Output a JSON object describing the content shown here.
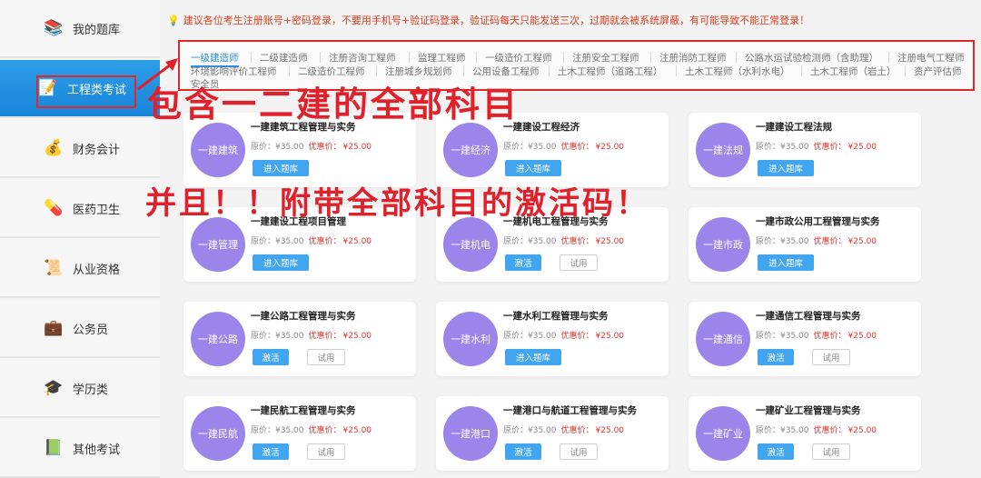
{
  "sidebar": {
    "items": [
      {
        "label": "我的题库",
        "icon": "books-icon"
      },
      {
        "label": "工程类考试",
        "icon": "pencil-paper-icon"
      },
      {
        "label": "财务会计",
        "icon": "coins-icon"
      },
      {
        "label": "医药卫生",
        "icon": "medicine-icon"
      },
      {
        "label": "从业资格",
        "icon": "certificate-icon"
      },
      {
        "label": "公务员",
        "icon": "briefcase-icon"
      },
      {
        "label": "学历类",
        "icon": "graduation-cap-icon"
      },
      {
        "label": "其他考试",
        "icon": "book-stack-icon"
      }
    ],
    "active_index": 1
  },
  "notice": "建议各位考生注册账号+密码登录，不要用手机号+验证码登录，验证码每天只能发送三次，过期就会被系统屏蔽，有可能导致不能正常登录！",
  "tabs": [
    "一级建造师",
    "二级建造师",
    "注册咨询工程师",
    "监理工程师",
    "一级造价工程师",
    "注册安全工程师",
    "注册消防工程师",
    "公路水运试验检测师（含助理）",
    "注册电气工程师",
    "环境影响评价工程师",
    "二级造价工程师",
    "注册城乡规划师",
    "公用设备工程师",
    "土木工程师（道路工程）",
    "土木工程师（水利水电）",
    "土木工程师（岩土）",
    "资产评估师",
    "安全员"
  ],
  "active_tab": 0,
  "price_labels": {
    "original": "原价：",
    "sale": "优惠价："
  },
  "cards": [
    {
      "short": "一建建筑",
      "title": "一建建筑工程管理与实务",
      "orig": "¥35.00",
      "sale": "¥25.00",
      "buttons": [
        "进入题库"
      ]
    },
    {
      "short": "一建经济",
      "title": "一建建设工程经济",
      "orig": "¥35.00",
      "sale": "¥25.00",
      "buttons": [
        "进入题库"
      ]
    },
    {
      "short": "一建法规",
      "title": "一建建设工程法规",
      "orig": "¥35.00",
      "sale": "¥25.00",
      "buttons": [
        "进入题库"
      ]
    },
    {
      "short": "一建管理",
      "title": "一建建设工程项目管理",
      "orig": "¥35.00",
      "sale": "¥25.00",
      "buttons": [
        "进入题库"
      ]
    },
    {
      "short": "一建机电",
      "title": "一建机电工程管理与实务",
      "orig": "¥35.00",
      "sale": "¥25.00",
      "buttons": [
        "激活",
        "试用"
      ]
    },
    {
      "short": "一建市政",
      "title": "一建市政公用工程管理与实务",
      "orig": "¥35.00",
      "sale": "¥25.00",
      "buttons": [
        "进入题库"
      ]
    },
    {
      "short": "一建公路",
      "title": "一建公路工程管理与实务",
      "orig": "¥35.00",
      "sale": "¥25.00",
      "buttons": [
        "激活",
        "试用"
      ]
    },
    {
      "short": "一建水利",
      "title": "一建水利工程管理与实务",
      "orig": "¥35.00",
      "sale": "¥25.00",
      "buttons": [
        "进入题库"
      ]
    },
    {
      "short": "一建通信",
      "title": "一建通信工程管理与实务",
      "orig": "¥35.00",
      "sale": "¥25.00",
      "buttons": [
        "激活",
        "试用"
      ]
    },
    {
      "short": "一建民航",
      "title": "一建民航工程管理与实务",
      "orig": "¥35.00",
      "sale": "¥25.00",
      "buttons": [
        "激活",
        "试用"
      ]
    },
    {
      "short": "一建港口",
      "title": "一建港口与航道工程管理与实务",
      "orig": "¥35.00",
      "sale": "¥25.00",
      "buttons": [
        "激活",
        "试用"
      ]
    },
    {
      "short": "一建矿业",
      "title": "一建矿业工程管理与实务",
      "orig": "¥35.00",
      "sale": "¥25.00",
      "buttons": [
        "激活",
        "试用"
      ]
    }
  ],
  "overlay": {
    "line1": "包含一二建的全部科目",
    "line2": "并且！！附带全部科目的激活码！"
  },
  "colors": {
    "accent_blue": "#2b8ee4",
    "sidebar_active": "#1784d8",
    "circle_purple": "#9b84ea",
    "annotation_red": "#e0202a",
    "sale_red": "#e03333"
  }
}
